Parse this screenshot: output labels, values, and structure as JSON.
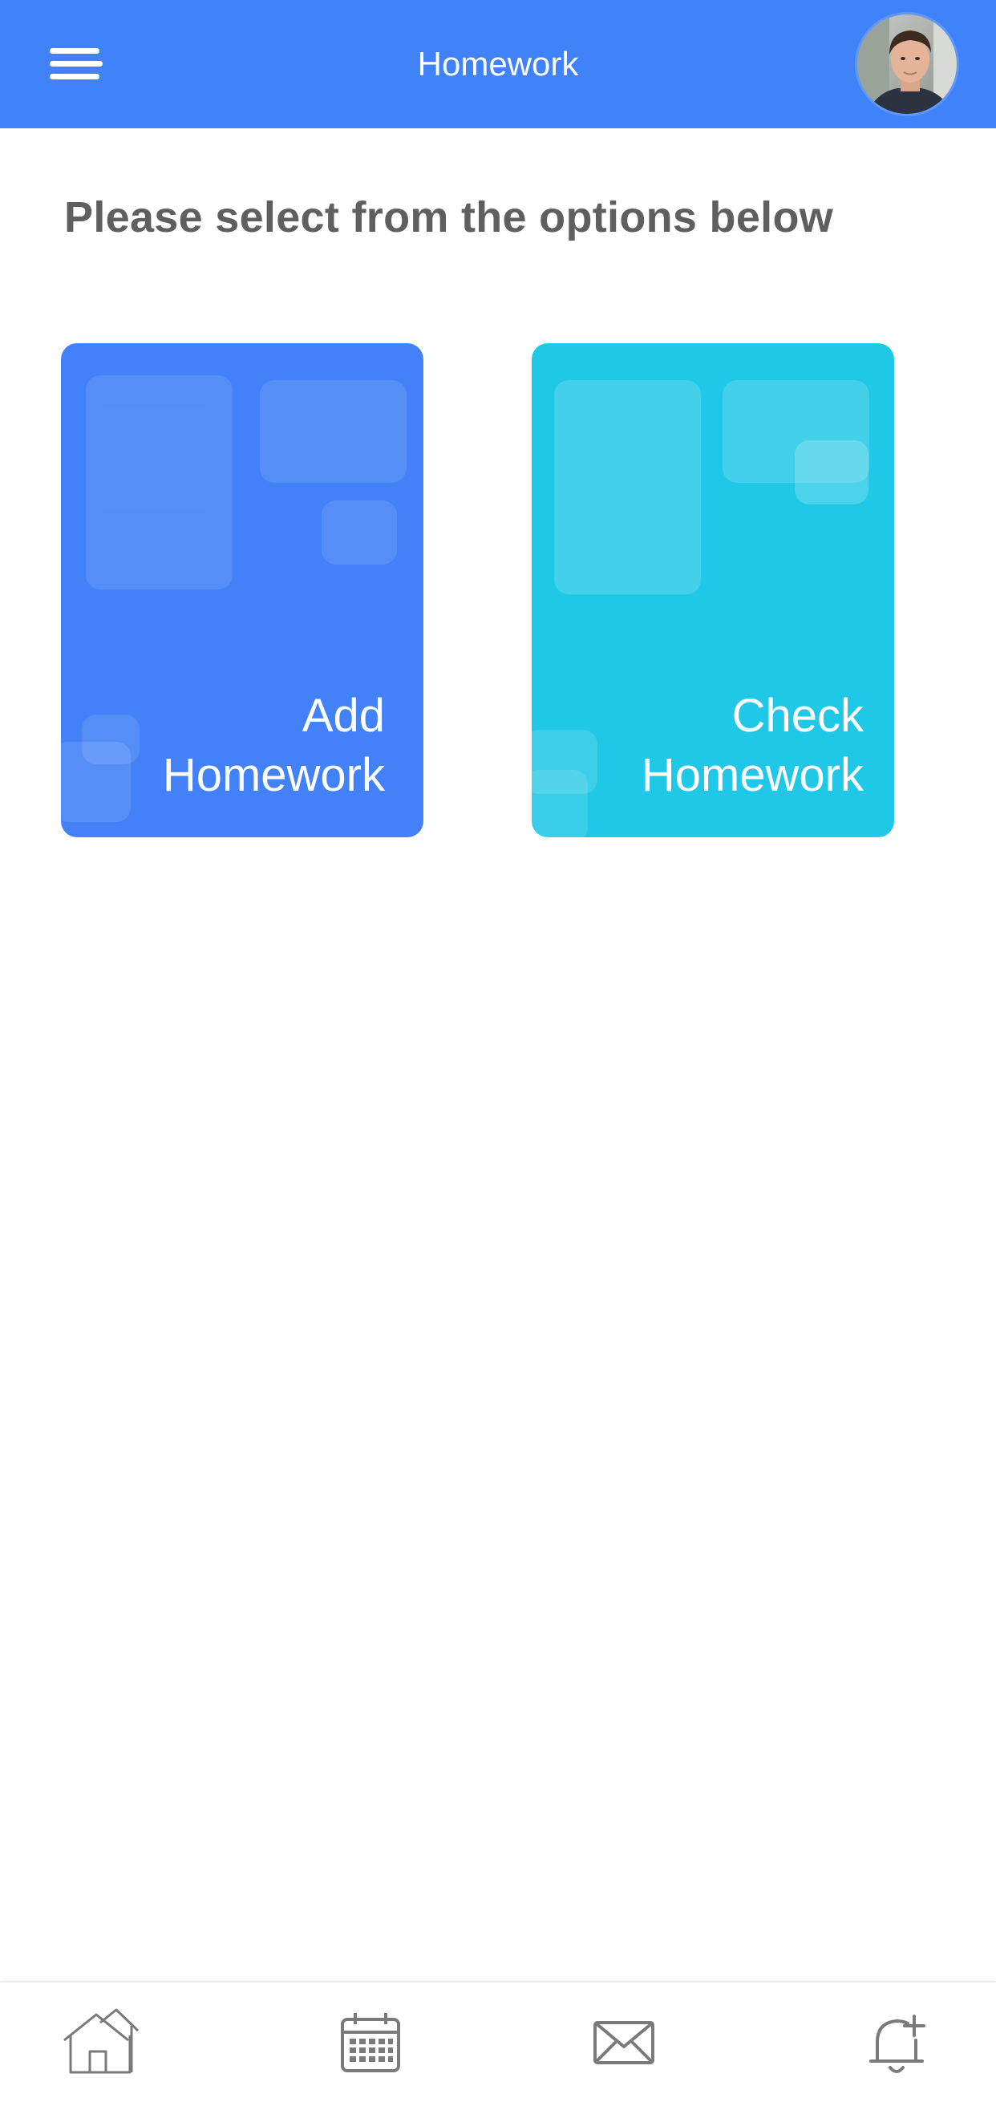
{
  "header": {
    "title": "Homework"
  },
  "instruction": "Please select from the options below",
  "cards": [
    {
      "line1": "Add",
      "line2": "Homework",
      "color": "#4281f7"
    },
    {
      "line1": "Check",
      "line2": "Homework",
      "color": "#1ec8e6"
    }
  ],
  "colors": {
    "header": "#4082f9",
    "icon_gray": "#7a7a7a"
  },
  "bottom_nav": [
    "home-icon",
    "calendar-icon",
    "mail-icon",
    "bell-add-icon"
  ]
}
